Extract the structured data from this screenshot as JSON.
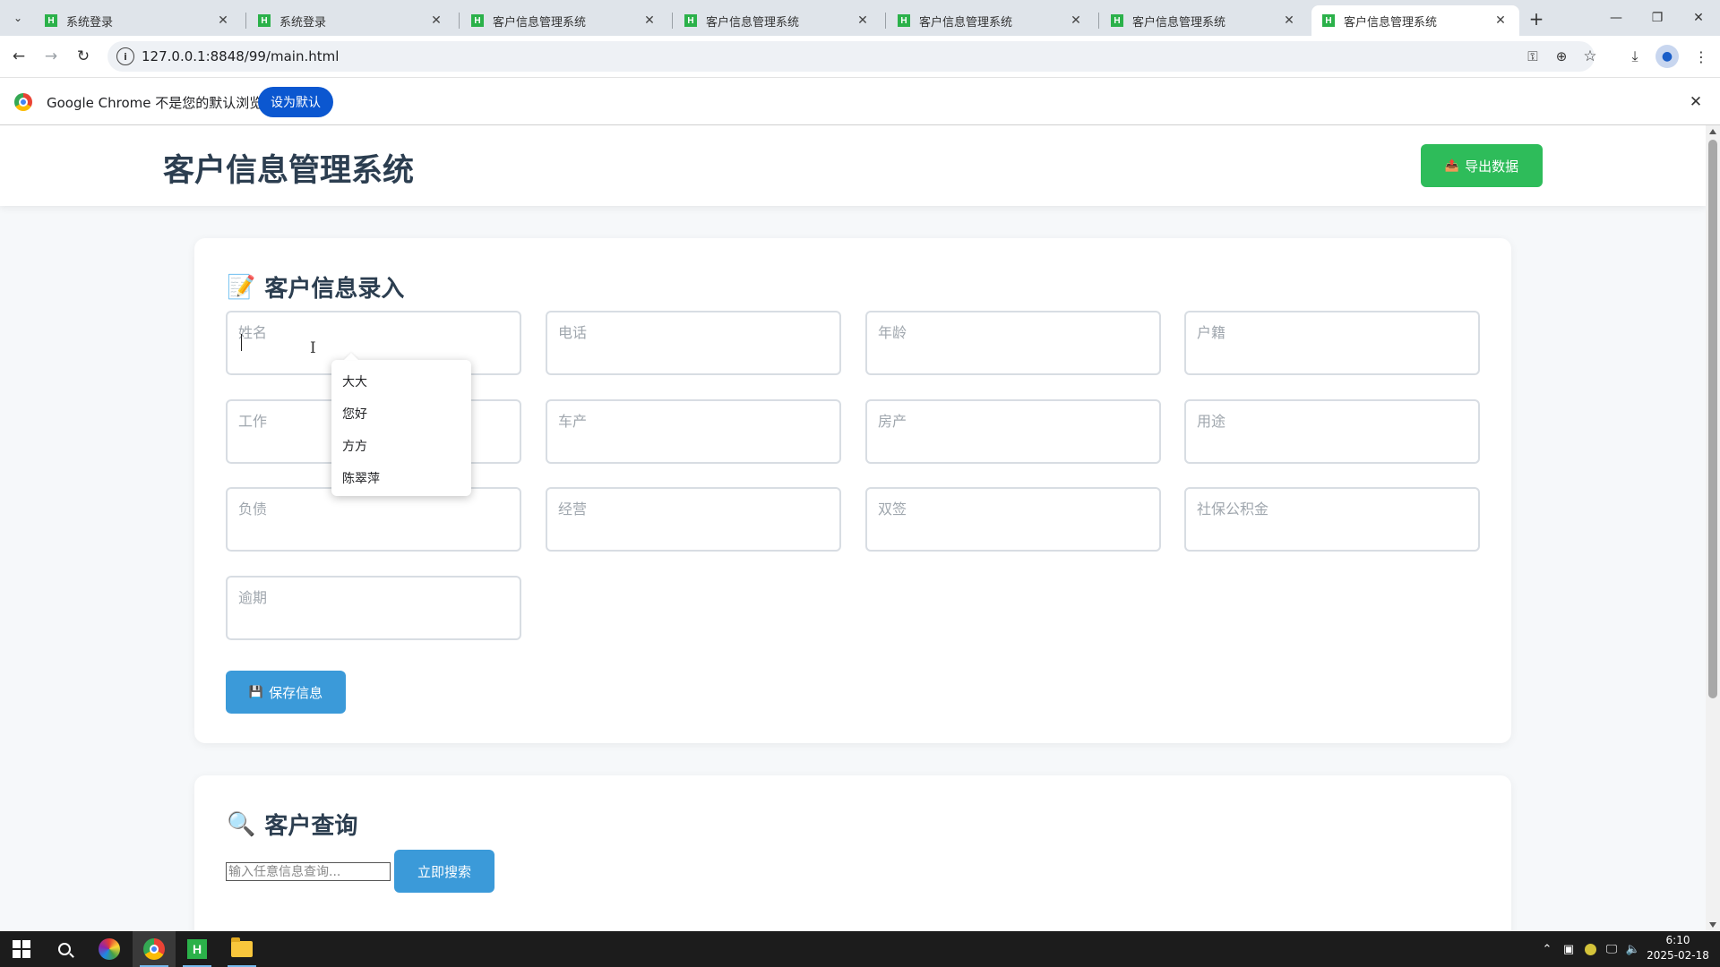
{
  "browser": {
    "tabs": [
      {
        "label": "系统登录",
        "active": false
      },
      {
        "label": "系统登录",
        "active": false
      },
      {
        "label": "客户信息管理系统",
        "active": false
      },
      {
        "label": "客户信息管理系统",
        "active": false
      },
      {
        "label": "客户信息管理系统",
        "active": false
      },
      {
        "label": "客户信息管理系统",
        "active": false
      },
      {
        "label": "客户信息管理系统",
        "active": true
      }
    ],
    "tab_favicon": "H",
    "url": "127.0.0.1:8848/99/main.html",
    "infobar": {
      "message": "Google Chrome 不是您的默认浏览器",
      "button_label": "设为默认"
    }
  },
  "app": {
    "title": "客户信息管理系统",
    "export_label": "导出数据",
    "export_icon": "📤",
    "entry_section": {
      "icon": "📝",
      "title": "客户信息录入",
      "fields": [
        {
          "placeholder": "姓名",
          "value": ""
        },
        {
          "placeholder": "电话",
          "value": ""
        },
        {
          "placeholder": "年龄",
          "value": ""
        },
        {
          "placeholder": "户籍",
          "value": ""
        },
        {
          "placeholder": "工作",
          "value": ""
        },
        {
          "placeholder": "车产",
          "value": ""
        },
        {
          "placeholder": "房产",
          "value": ""
        },
        {
          "placeholder": "用途",
          "value": ""
        },
        {
          "placeholder": "负债",
          "value": ""
        },
        {
          "placeholder": "经营",
          "value": ""
        },
        {
          "placeholder": "双签",
          "value": ""
        },
        {
          "placeholder": "社保公积金",
          "value": ""
        },
        {
          "placeholder": "逾期",
          "value": ""
        }
      ],
      "save_icon": "💾",
      "save_label": "保存信息"
    },
    "autocomplete": [
      "大大",
      "您好",
      "方方",
      "陈翠萍"
    ],
    "search_section": {
      "icon": "🔍",
      "title": "客户查询",
      "placeholder": "输入任意信息查询...",
      "button_label": "立即搜索"
    }
  },
  "taskbar": {
    "clock_time": "6:10",
    "clock_date": "2025-02-18"
  },
  "colors": {
    "primary_blue": "#3b9ad9",
    "export_green": "#2ebc5a",
    "title_text": "#2c3e50",
    "chrome_button": "#0b57d0"
  }
}
